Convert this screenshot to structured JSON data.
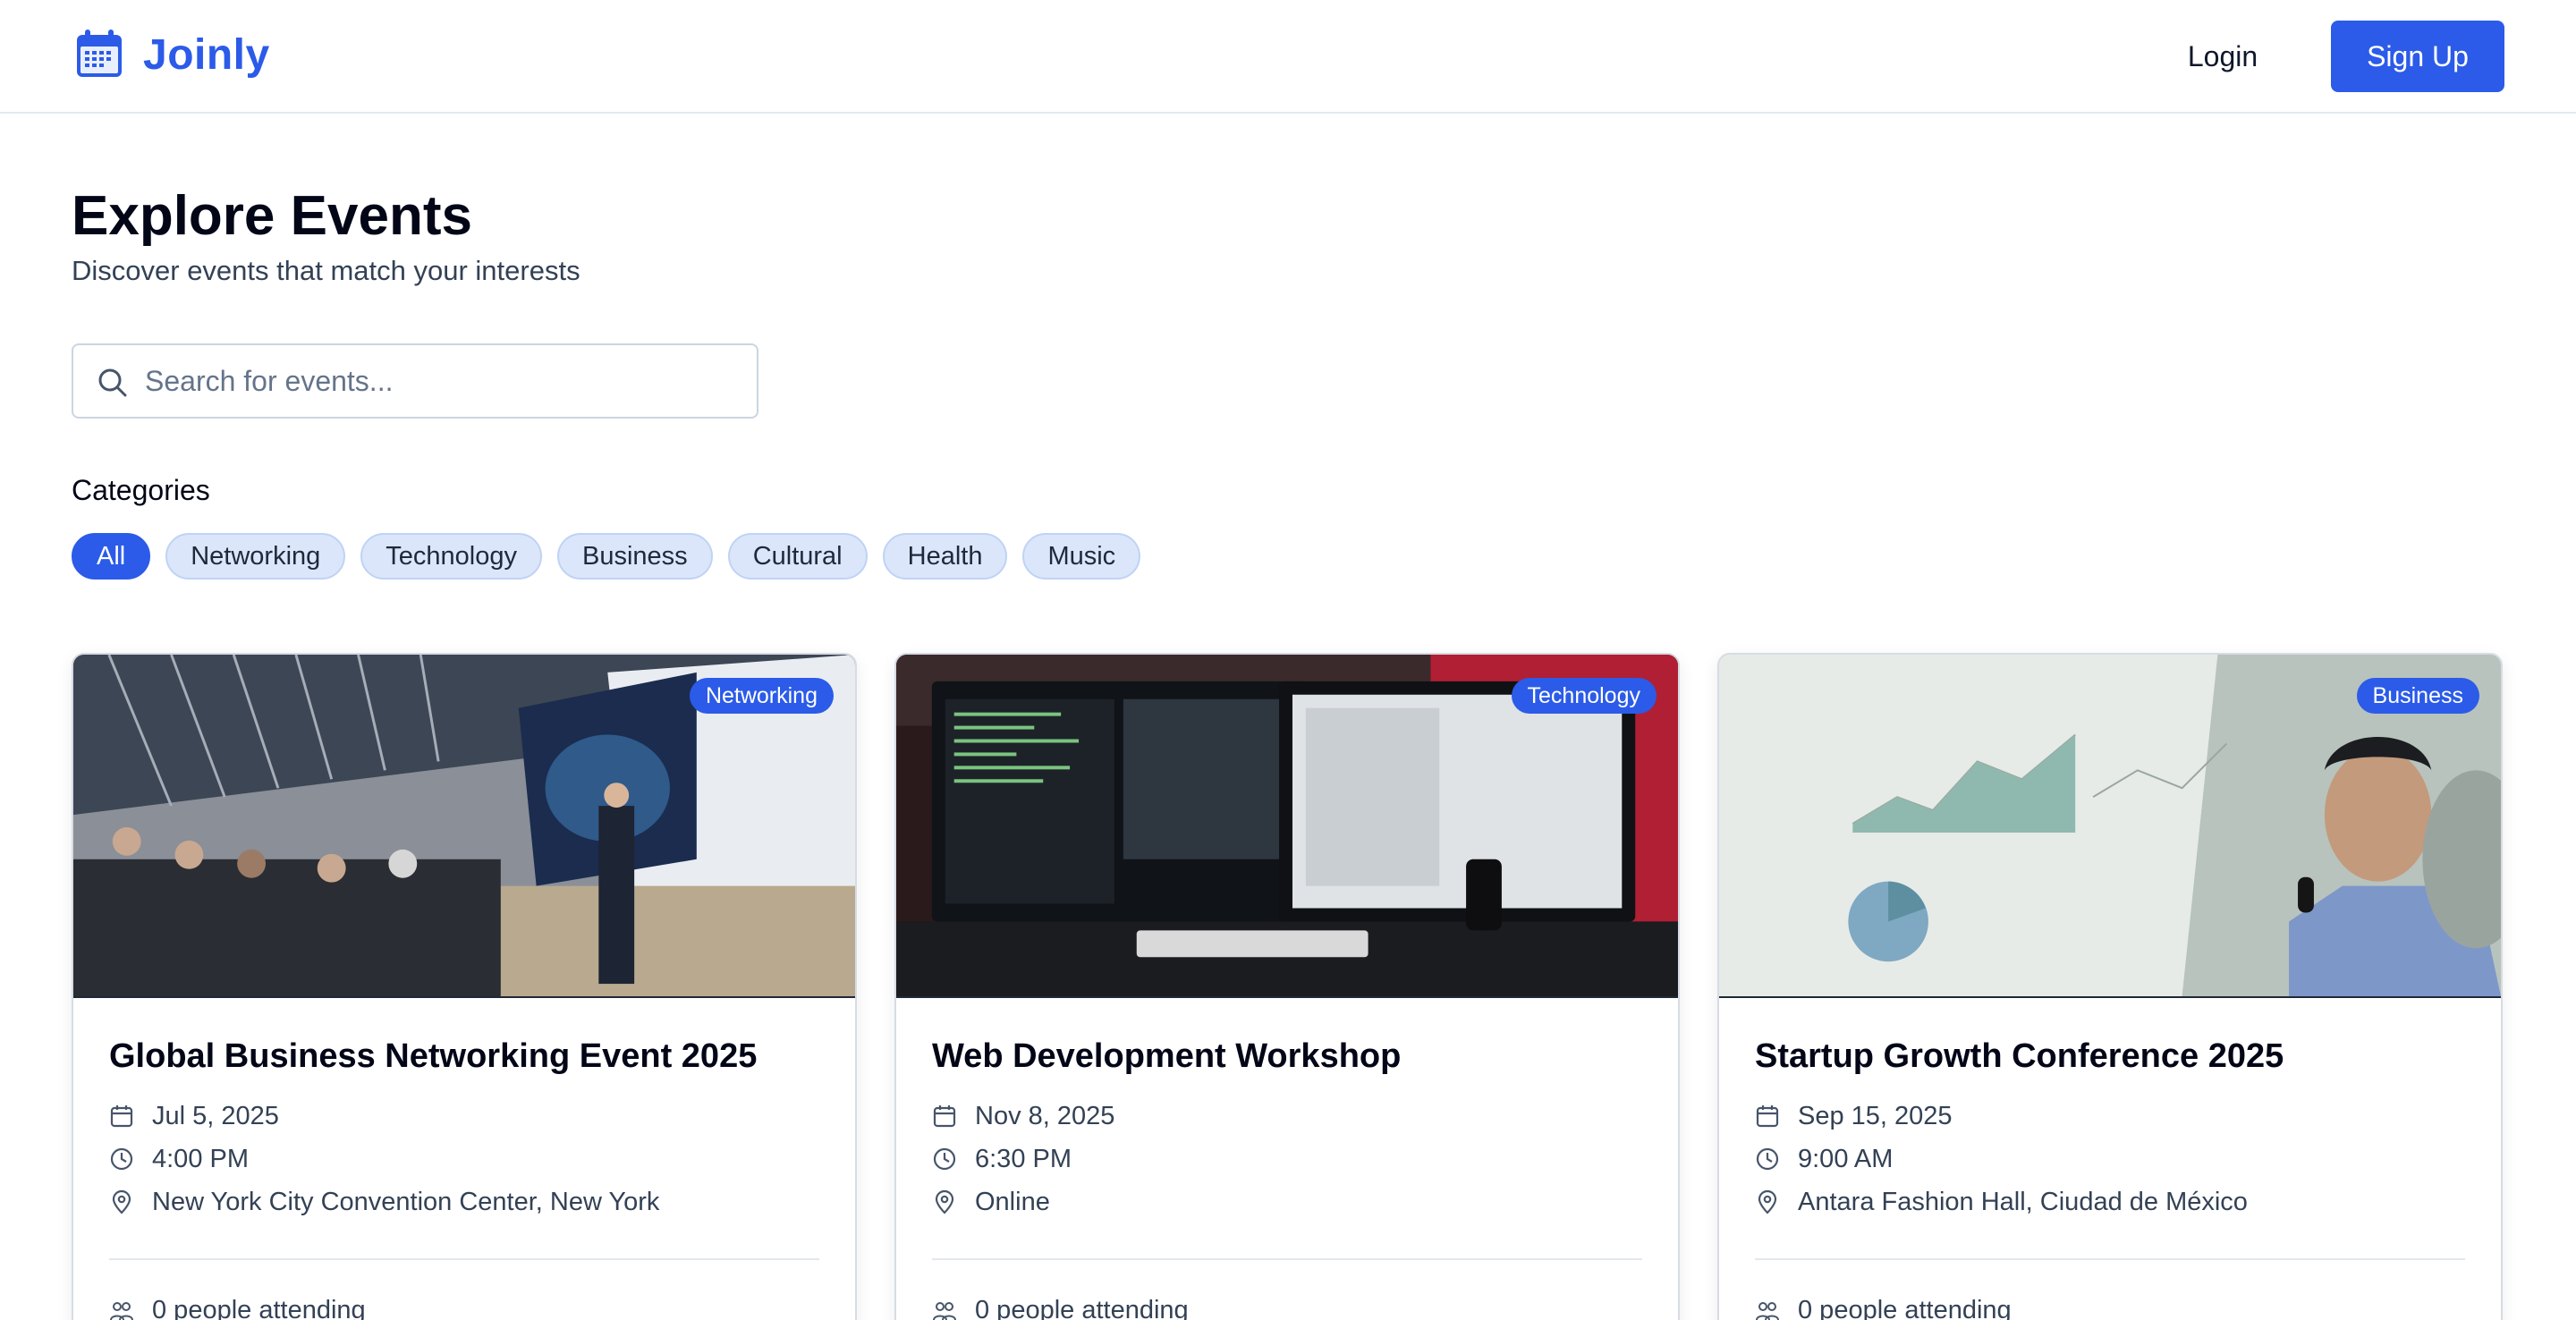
{
  "header": {
    "brand": "Joinly",
    "login_label": "Login",
    "signup_label": "Sign Up"
  },
  "page": {
    "title": "Explore Events",
    "subtitle": "Discover events that match your interests"
  },
  "search": {
    "placeholder": "Search for events...",
    "value": ""
  },
  "categories": {
    "label": "Categories",
    "items": [
      "All",
      "Networking",
      "Technology",
      "Business",
      "Cultural",
      "Health",
      "Music"
    ],
    "selected": "All"
  },
  "events": [
    {
      "category": "Networking",
      "title": "Global Business Networking Event 2025",
      "date": "Jul 5, 2025",
      "time": "4:00 PM",
      "location": "New York City Convention Center, New York",
      "attending": "0 people attending"
    },
    {
      "category": "Technology",
      "title": "Web Development Workshop",
      "date": "Nov 8, 2025",
      "time": "6:30 PM",
      "location": "Online",
      "attending": "0 people attending"
    },
    {
      "category": "Business",
      "title": "Startup Growth Conference 2025",
      "date": "Sep 15, 2025",
      "time": "9:00 AM",
      "location": "Antara Fashion Hall, Ciudad de México",
      "attending": "0 people attending"
    }
  ],
  "colors": {
    "accent": "#2b5be8",
    "chip_bg": "#dbe6fa",
    "border": "#e2e8f0"
  },
  "icons": {
    "brand": "calendar-icon",
    "search": "search-icon",
    "date": "calendar-icon",
    "time": "clock-icon",
    "location": "map-pin-icon",
    "attending": "people-icon"
  }
}
